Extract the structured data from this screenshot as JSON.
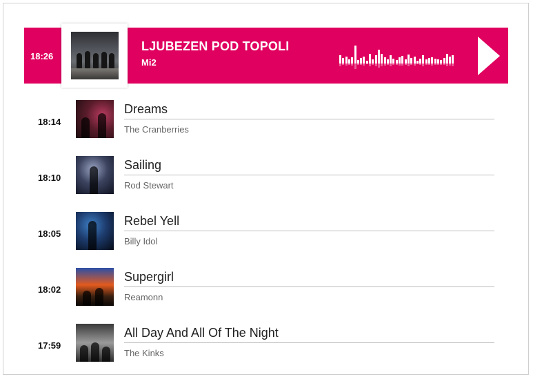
{
  "now_playing": {
    "time": "18:26",
    "title": "LJUBEZEN POD TOPOLI",
    "artist": "Mi2",
    "cover_icon": "album-cover-image",
    "play_icon": "play-triangle-icon",
    "accent_color": "#e0005f"
  },
  "history": [
    {
      "time": "18:14",
      "title": "Dreams",
      "artist": "The Cranberries"
    },
    {
      "time": "18:10",
      "title": "Sailing",
      "artist": "Rod Stewart"
    },
    {
      "time": "18:05",
      "title": "Rebel Yell",
      "artist": "Billy Idol"
    },
    {
      "time": "18:02",
      "title": "Supergirl",
      "artist": "Reamonn"
    },
    {
      "time": "17:59",
      "title": "All Day And All Of The Night",
      "artist": "The Kinks"
    }
  ]
}
